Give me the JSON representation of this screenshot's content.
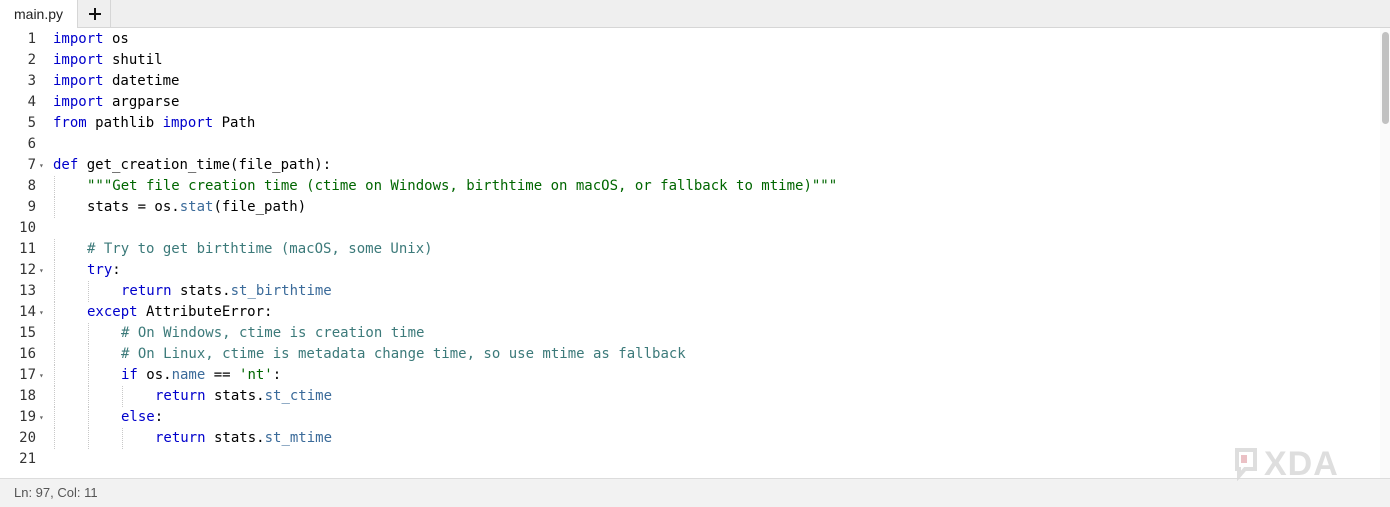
{
  "tabs": [
    {
      "label": "main.py",
      "active": true
    }
  ],
  "tab_add_icon": "plus-icon",
  "code": [
    {
      "n": "1",
      "tokens": [
        [
          "kw",
          "import"
        ],
        [
          "ident",
          " os"
        ]
      ]
    },
    {
      "n": "2",
      "tokens": [
        [
          "kw",
          "import"
        ],
        [
          "ident",
          " shutil"
        ]
      ]
    },
    {
      "n": "3",
      "tokens": [
        [
          "kw",
          "import"
        ],
        [
          "ident",
          " datetime"
        ]
      ]
    },
    {
      "n": "4",
      "tokens": [
        [
          "kw",
          "import"
        ],
        [
          "ident",
          " argparse"
        ]
      ]
    },
    {
      "n": "5",
      "tokens": [
        [
          "kw",
          "from"
        ],
        [
          "ident",
          " pathlib "
        ],
        [
          "kw",
          "import"
        ],
        [
          "ident",
          " Path"
        ]
      ]
    },
    {
      "n": "6",
      "tokens": []
    },
    {
      "n": "7",
      "fold": true,
      "tokens": [
        [
          "kw",
          "def"
        ],
        [
          "ident",
          " get_creation_time(file_path):"
        ]
      ]
    },
    {
      "n": "8",
      "indent": 1,
      "tokens": [
        [
          "str",
          "\"\"\"Get file creation time (ctime on Windows, birthtime on macOS, or fallback to mtime)\"\"\""
        ]
      ]
    },
    {
      "n": "9",
      "indent": 1,
      "tokens": [
        [
          "ident",
          "stats = os."
        ],
        [
          "attr",
          "stat"
        ],
        [
          "ident",
          "(file_path)"
        ]
      ]
    },
    {
      "n": "10",
      "tokens": []
    },
    {
      "n": "11",
      "indent": 1,
      "tokens": [
        [
          "cmt",
          "# Try to get birthtime (macOS, some Unix)"
        ]
      ]
    },
    {
      "n": "12",
      "fold": true,
      "indent": 1,
      "tokens": [
        [
          "kw",
          "try"
        ],
        [
          "ident",
          ":"
        ]
      ]
    },
    {
      "n": "13",
      "indent": 2,
      "tokens": [
        [
          "kw",
          "return"
        ],
        [
          "ident",
          " stats."
        ],
        [
          "attr",
          "st_birthtime"
        ]
      ]
    },
    {
      "n": "14",
      "fold": true,
      "indent": 1,
      "tokens": [
        [
          "kw",
          "except"
        ],
        [
          "ident",
          " AttributeError:"
        ]
      ]
    },
    {
      "n": "15",
      "indent": 2,
      "tokens": [
        [
          "cmt",
          "# On Windows, ctime is creation time"
        ]
      ]
    },
    {
      "n": "16",
      "indent": 2,
      "tokens": [
        [
          "cmt",
          "# On Linux, ctime is metadata change time, so use mtime as fallback"
        ]
      ]
    },
    {
      "n": "17",
      "fold": true,
      "indent": 2,
      "tokens": [
        [
          "kw",
          "if"
        ],
        [
          "ident",
          " os."
        ],
        [
          "attr",
          "name"
        ],
        [
          "ident",
          " == "
        ],
        [
          "str",
          "'nt'"
        ],
        [
          "ident",
          ":"
        ]
      ]
    },
    {
      "n": "18",
      "indent": 3,
      "tokens": [
        [
          "kw",
          "return"
        ],
        [
          "ident",
          " stats."
        ],
        [
          "attr",
          "st_ctime"
        ]
      ]
    },
    {
      "n": "19",
      "fold": true,
      "indent": 2,
      "tokens": [
        [
          "kw",
          "else"
        ],
        [
          "ident",
          ":"
        ]
      ]
    },
    {
      "n": "20",
      "indent": 3,
      "tokens": [
        [
          "kw",
          "return"
        ],
        [
          "ident",
          " stats."
        ],
        [
          "attr",
          "st_mtime"
        ]
      ]
    },
    {
      "n": "21",
      "tokens": []
    }
  ],
  "status": {
    "position": "Ln: 97,  Col: 11"
  },
  "watermark": {
    "text": "XDA"
  },
  "colors": {
    "keyword": "#0000cc",
    "string": "#006600",
    "comment": "#3c7a7a",
    "attribute": "#3b6b9a"
  }
}
